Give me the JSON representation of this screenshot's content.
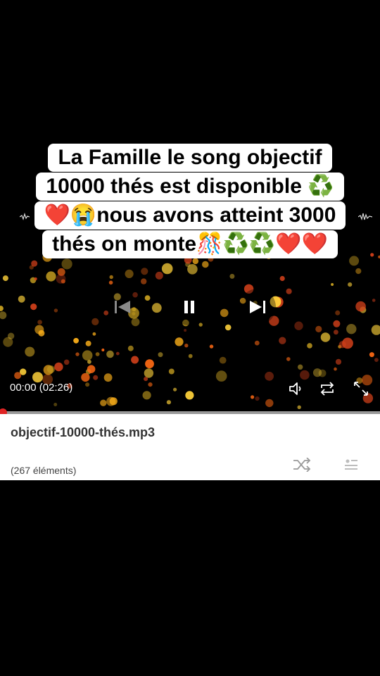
{
  "caption": {
    "line1": "La Famille le song objectif",
    "line2": "10000 thés est disponible ♻️",
    "line3": "❤️😭nous avons atteint 3000",
    "line4": "thés on monte🎊♻️♻️❤️❤️"
  },
  "player": {
    "time_display": "00:00 (02:26)",
    "progress": 0.0
  },
  "track": {
    "filename": "objectif-10000-thés.mp3",
    "items_count": "(267 éléments)"
  },
  "colors": {
    "accent": "#e02424",
    "bokeh_warm": "#ffb21a",
    "bokeh_orange": "#ff6a13"
  },
  "icons": [
    "previous-icon",
    "pause-icon",
    "next-icon",
    "volume-icon",
    "repeat-icon",
    "fullscreen-icon",
    "shuffle-icon",
    "playlist-icon"
  ]
}
